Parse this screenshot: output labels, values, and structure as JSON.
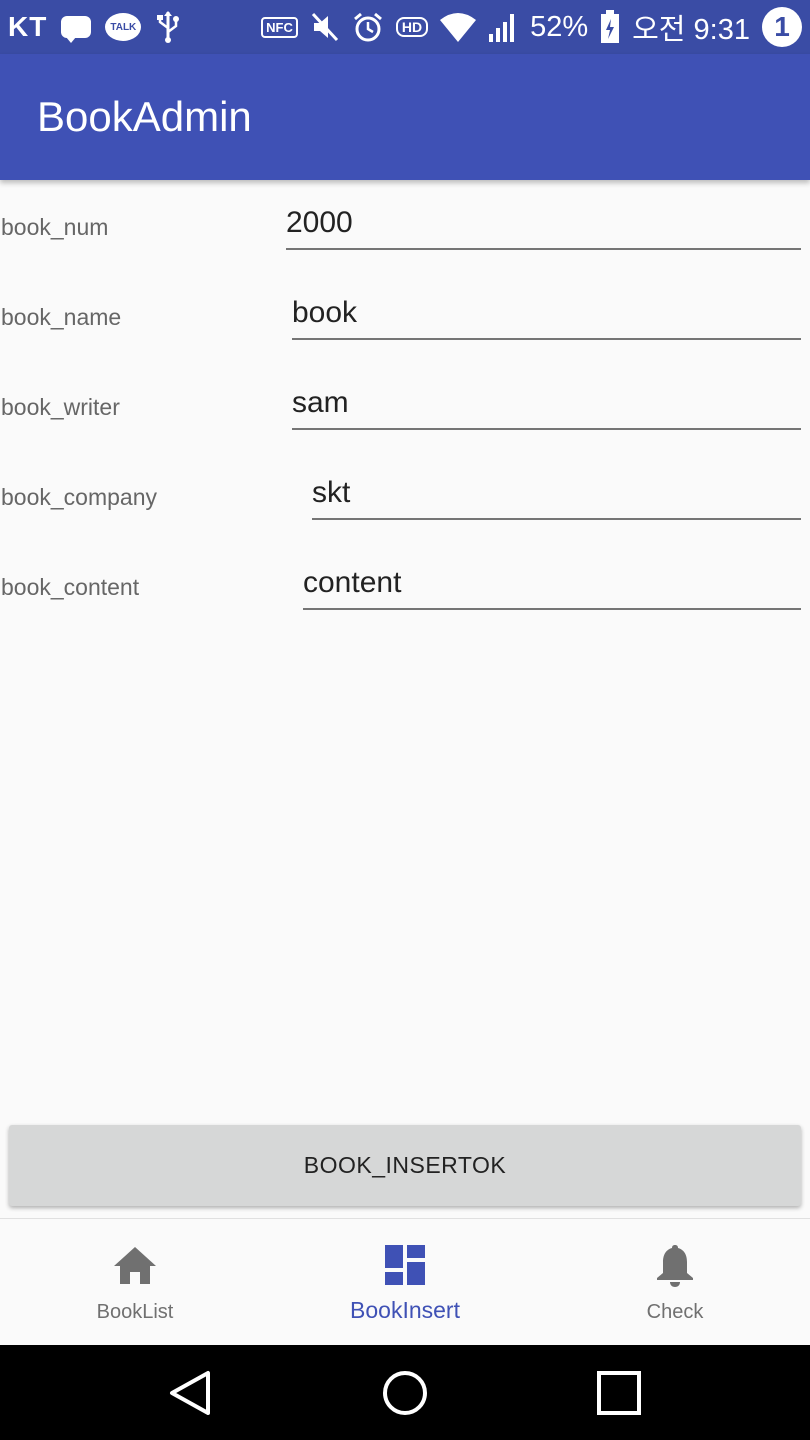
{
  "status_bar": {
    "carrier": "KT",
    "icons": [
      "chat-bubble-icon",
      "kakaotalk-icon",
      "usb-icon",
      "nfc-icon",
      "mute-icon",
      "alarm-icon",
      "hd-icon",
      "wifi-icon",
      "signal-icon",
      "battery-icon"
    ],
    "talk_label": "TALK",
    "nfc_label": "NFC",
    "hd_label": "HD",
    "battery": "52%",
    "time": "오전 9:31",
    "notification_count": "1"
  },
  "appbar": {
    "title": "BookAdmin"
  },
  "form": {
    "fields": [
      {
        "label": "book_num",
        "value": "2000"
      },
      {
        "label": "book_name",
        "value": "book"
      },
      {
        "label": "book_writer",
        "value": "sam"
      },
      {
        "label": "book_company",
        "value": "skt"
      },
      {
        "label": "book_content",
        "value": "content"
      }
    ],
    "submit_label": "BOOK_INSERTOK"
  },
  "bottom_nav": {
    "items": [
      {
        "label": "BookList",
        "icon": "home-icon",
        "active": false
      },
      {
        "label": "BookInsert",
        "icon": "dashboard-icon",
        "active": true
      },
      {
        "label": "Check",
        "icon": "bell-icon",
        "active": false
      }
    ]
  },
  "system_nav": {
    "buttons": [
      "back-icon",
      "home-circle-icon",
      "recents-icon"
    ]
  },
  "colors": {
    "status_bar": "#3a4ca5",
    "primary": "#3f51b5",
    "background": "#fafafa",
    "button": "#d6d7d7",
    "inactive": "#707070"
  }
}
